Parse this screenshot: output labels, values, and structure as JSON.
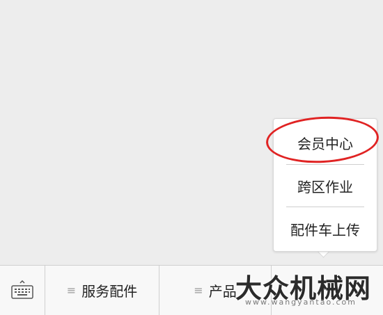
{
  "popup_menu": {
    "items": [
      {
        "label": "会员中心",
        "highlighted": true
      },
      {
        "label": "跨区作业",
        "highlighted": false
      },
      {
        "label": "配件车上传",
        "highlighted": false
      }
    ]
  },
  "menu_bar": {
    "keyboard_icon": "keyboard-icon",
    "tabs": [
      {
        "label": "服务配件",
        "icon": "menu-lines-icon"
      },
      {
        "label": "产品",
        "icon": "menu-lines-icon"
      },
      {
        "label": "",
        "icon": "menu-lines-icon"
      }
    ]
  },
  "watermark": {
    "title": "大众机械网",
    "url": "www.wangyantao.com"
  },
  "colors": {
    "highlight_ring": "#e02323",
    "background": "#ededed"
  }
}
